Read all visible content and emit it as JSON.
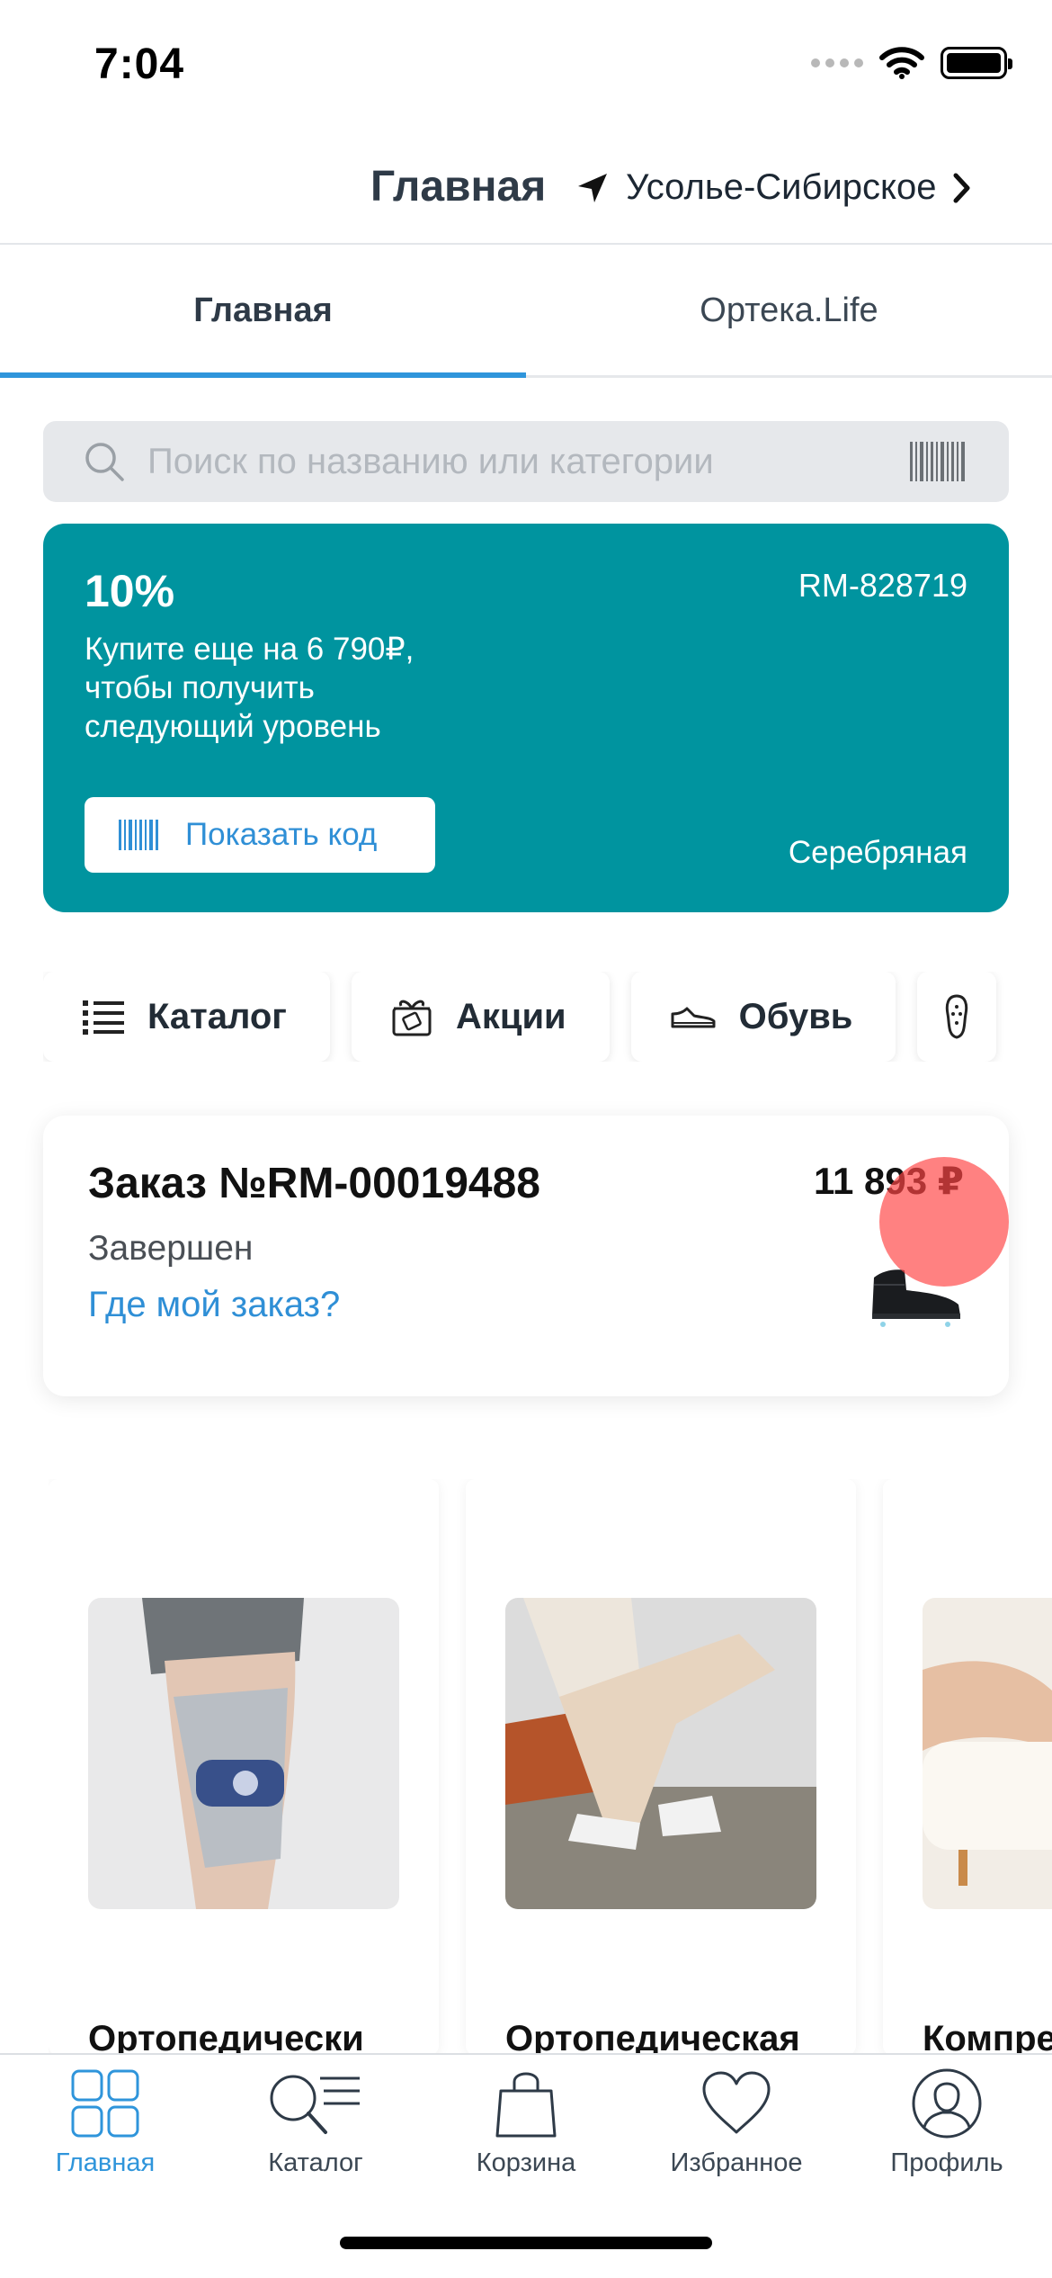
{
  "status_bar": {
    "time": "7:04"
  },
  "header": {
    "title": "Главная",
    "location": "Усолье-Сибирское"
  },
  "tabs": [
    {
      "label": "Главная",
      "active": true
    },
    {
      "label": "Ортека.Life",
      "active": false
    }
  ],
  "search": {
    "placeholder": "Поиск по названию или категории"
  },
  "loyalty": {
    "percent": "10%",
    "card_number": "RM-828719",
    "text": "Купите еще на 6 790₽,\nчтобы получить\nследующий уровень",
    "button_label": "Показать код",
    "level": "Серебряная",
    "color": "#00949f"
  },
  "categories": [
    {
      "label": "Каталог",
      "icon": "list-icon"
    },
    {
      "label": "Акции",
      "icon": "gift-tag-icon"
    },
    {
      "label": "Обувь",
      "icon": "shoe-icon"
    },
    {
      "label": "",
      "icon": "insole-icon"
    }
  ],
  "order": {
    "title": "Заказ №RM-00019488",
    "price": "11 893 ₽",
    "status": "Завершен",
    "link": "Где мой заказ?"
  },
  "products": [
    {
      "title": "Ортопедически",
      "image": "knee-brace-photo"
    },
    {
      "title": "Ортопедическая",
      "image": "sneakers-photo"
    },
    {
      "title": "Компре",
      "image": "compression-legs-photo"
    }
  ],
  "tabbar": [
    {
      "label": "Главная",
      "icon": "grid-icon",
      "active": true
    },
    {
      "label": "Каталог",
      "icon": "search-list-icon",
      "active": false
    },
    {
      "label": "Корзина",
      "icon": "bag-icon",
      "active": false
    },
    {
      "label": "Избранное",
      "icon": "heart-icon",
      "active": false
    },
    {
      "label": "Профиль",
      "icon": "profile-icon",
      "active": false
    }
  ],
  "colors": {
    "accent": "#2f95db",
    "teal": "#00949f",
    "link": "#2f8fd6"
  }
}
